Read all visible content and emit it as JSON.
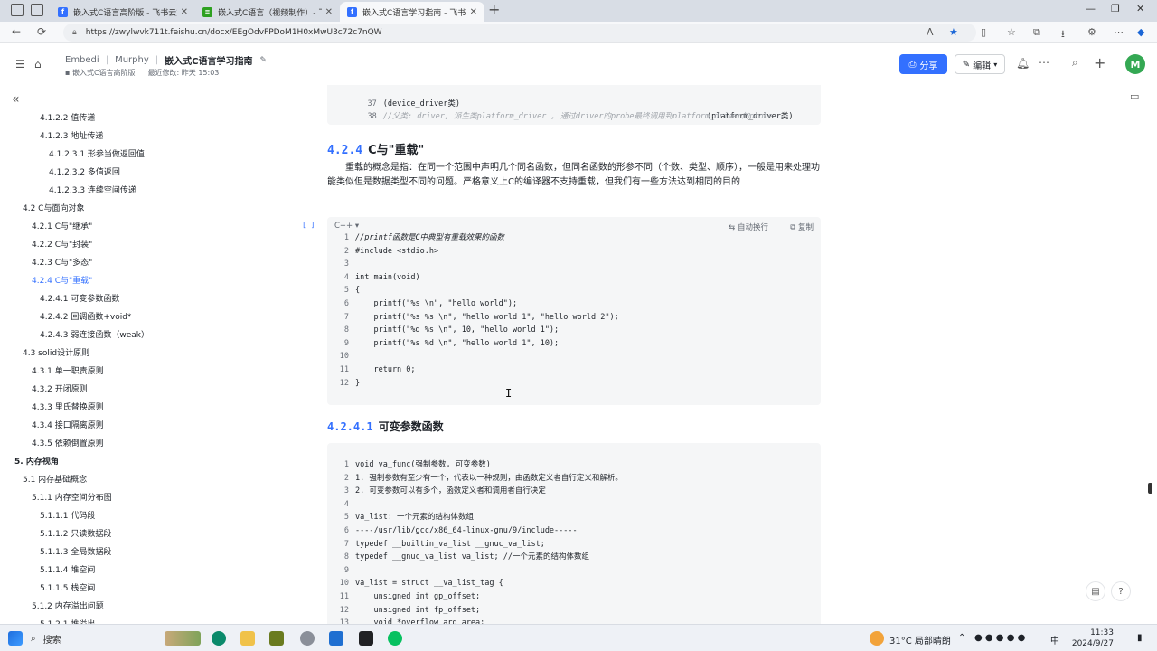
{
  "browser": {
    "tabs": [
      {
        "title": "嵌入式C语言高阶版 - 飞书云文档",
        "fav_color": "#3370ff",
        "fav_text": "f"
      },
      {
        "title": "嵌入式C语言（视频制作）- 飞书",
        "fav_color": "#2ea121",
        "fav_text": "≡"
      },
      {
        "title": "嵌入式C语言学习指南 - 飞书云文",
        "fav_color": "#3370ff",
        "fav_text": "f"
      }
    ],
    "url": "https://zwylwvk711t.feishu.cn/docx/EEgOdvFPDoM1H0xMwU3c72c7nQW"
  },
  "header": {
    "breadcrumbs": [
      "Embedi",
      "Murphy",
      "嵌入式C语言学习指南"
    ],
    "parent_doc": "嵌入式C语言高阶版",
    "last_modified": "最近修改: 昨天 15:03",
    "share_label": "分享",
    "edit_label": "编辑",
    "avatar_letter": "M"
  },
  "toc": [
    {
      "label": "4.1.2.2 值传递",
      "level": 3
    },
    {
      "label": "4.1.2.3 地址传递",
      "level": 3
    },
    {
      "label": "4.1.2.3.1 形参当做返回值",
      "level": 4
    },
    {
      "label": "4.1.2.3.2 多值返回",
      "level": 4
    },
    {
      "label": "4.1.2.3.3 连续空间传递",
      "level": 4
    },
    {
      "label": "4.2 C与面向对象",
      "level": 1
    },
    {
      "label": "4.2.1 C与\"继承\"",
      "level": 2
    },
    {
      "label": "4.2.2 C与\"封装\"",
      "level": 2
    },
    {
      "label": "4.2.3 C与\"多态\"",
      "level": 2
    },
    {
      "label": "4.2.4 C与\"重载\"",
      "level": 2,
      "active": true
    },
    {
      "label": "4.2.4.1 可变参数函数",
      "level": 3
    },
    {
      "label": "4.2.4.2 回调函数+void*",
      "level": 3
    },
    {
      "label": "4.2.4.3 弱连接函数（weak）",
      "level": 3
    },
    {
      "label": "4.3 solid设计原则",
      "level": 1
    },
    {
      "label": "4.3.1 单一职责原则",
      "level": 2
    },
    {
      "label": "4.3.2 开闭原则",
      "level": 2
    },
    {
      "label": "4.3.3 里氏替换原则",
      "level": 2
    },
    {
      "label": "4.3.4 接口隔离原则",
      "level": 2
    },
    {
      "label": "4.3.5 依赖倒置原则",
      "level": 2
    },
    {
      "label": "5. 内存视角",
      "level": 0,
      "bold": true
    },
    {
      "label": "5.1 内存基础概念",
      "level": 1
    },
    {
      "label": "5.1.1 内存空间分布图",
      "level": 2
    },
    {
      "label": "5.1.1.1 代码段",
      "level": 3
    },
    {
      "label": "5.1.1.2 只读数据段",
      "level": 3
    },
    {
      "label": "5.1.1.3 全局数据段",
      "level": 3
    },
    {
      "label": "5.1.1.4 堆空间",
      "level": 3
    },
    {
      "label": "5.1.1.5 栈空间",
      "level": 3
    },
    {
      "label": "5.1.2 内存溢出问题",
      "level": 2
    },
    {
      "label": "5.1.2.1 堆溢出",
      "level": 3
    }
  ],
  "content": {
    "top_code": [
      {
        "n": "37",
        "left": "(device_driver类)",
        "right": "(platform_driver类)"
      },
      {
        "n": "38",
        "comment": "//父类: driver, 派生类platform_driver , 通过driver的probe最终调用到platform_driver的probe"
      }
    ],
    "section_num": "4.2.4",
    "section_title": "C与\"重载\"",
    "paragraph": "重载的概念是指：在同一个范围中声明几个同名函数，但同名函数的形参不同（个数、类型、顺序），一般是用来处理功能类似但是数据类型不同的问题。严格意义上C的编译器不支持重载，但我们有一些方法达到相同的目的",
    "code_lang": "C++",
    "wrap_label": "自动换行",
    "copy_label": "复制",
    "code_handle": "[ ]",
    "code_lines": [
      "//printf函数是C中典型有重载效果的函数",
      "#include <stdio.h>",
      "",
      "int main(void)",
      "{",
      "    printf(\"%s \\n\", \"hello world\");",
      "    printf(\"%s %s \\n\", \"hello world 1\", \"hello world 2\");",
      "    printf(\"%d %s \\n\", 10, \"hello world 1\");",
      "    printf(\"%s %d \\n\", \"hello world 1\", 10);",
      "",
      "    return 0;",
      "}"
    ],
    "subsection_num": "4.2.4.1",
    "subsection_title": "可变参数函数",
    "code2_lines": [
      "void va_func(强制参数, 可变参数)",
      "1. 强制参数有至少有一个，代表以一种规则，由函数定义者自行定义和解析。",
      "2. 可变参数可以有多个，函数定义者和调用者自行决定",
      "",
      "va_list: 一个元素的结构体数组",
      "----/usr/lib/gcc/x86_64-linux-gnu/9/include-----",
      "typedef __builtin_va_list __gnuc_va_list;",
      "typedef __gnuc_va_list va_list; //一个元素的结构体数组",
      "",
      "va_list = struct __va_list_tag {",
      "    unsigned int gp_offset;",
      "    unsigned int fp_offset;",
      "    void *overflow_arg_area;"
    ]
  },
  "taskbar": {
    "search_label": "搜索",
    "weather": "31°C  局部晴朗",
    "ime": "中",
    "time": "11:33",
    "date": "2024/9/27"
  }
}
